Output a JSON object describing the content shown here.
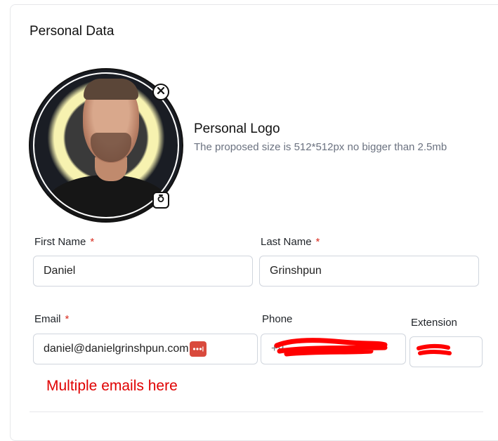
{
  "section": {
    "title": "Personal Data"
  },
  "logo": {
    "title": "Personal Logo",
    "subtitle": "The proposed size is 512*512px no bigger than 2.5mb"
  },
  "form": {
    "first_name": {
      "label": "First Name",
      "required": "*",
      "value": "Daniel"
    },
    "last_name": {
      "label": "Last Name",
      "required": "*",
      "value": "Grinshpun"
    },
    "email": {
      "label": "Email",
      "required": "*",
      "value": "daniel@danielgrinshpun.com"
    },
    "phone": {
      "label": "Phone",
      "value": "+9"
    },
    "extension": {
      "label": "Extension",
      "value": ""
    }
  },
  "annotation": {
    "text": "Multiple emails here"
  },
  "colors": {
    "required": "#d92d20",
    "annotation": "#e00000",
    "redaction": "#ff0000"
  }
}
